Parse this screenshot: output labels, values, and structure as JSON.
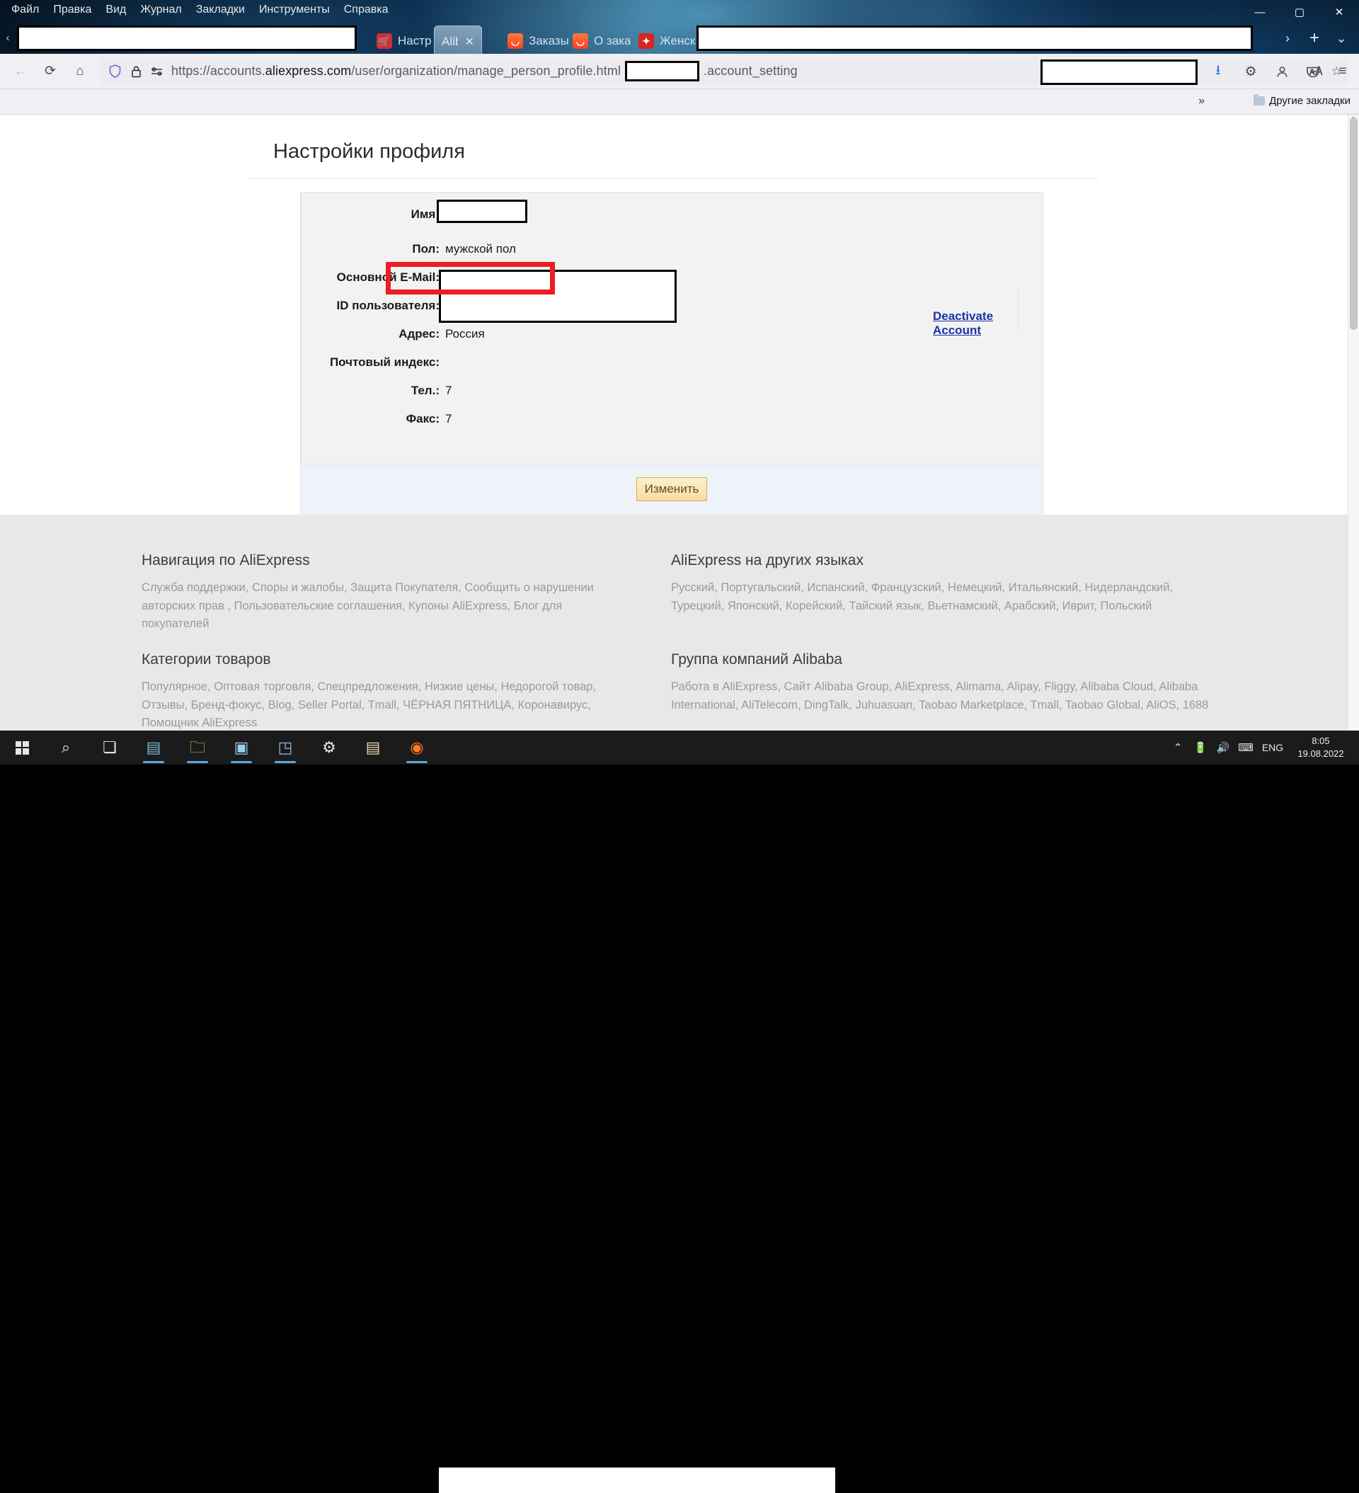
{
  "browser": {
    "menu_items": [
      "Файл",
      "Правка",
      "Вид",
      "Журнал",
      "Закладки",
      "Инструменты",
      "Справка"
    ],
    "window_controls": {
      "minimize": "—",
      "maximize": "▢",
      "close": "✕"
    },
    "tabs": [
      {
        "label": "Настр",
        "icon": "cart-icon",
        "active": false
      },
      {
        "label": "Alibaba",
        "icon": "none",
        "active": true,
        "close": "✕"
      },
      {
        "label": "Заказы",
        "icon": "aliexpress-icon",
        "active": false
      },
      {
        "label": "О зака",
        "icon": "aliexpress-icon",
        "active": false
      },
      {
        "label": "Женск",
        "icon": "star-icon",
        "active": false
      }
    ],
    "tab_new_label": "+",
    "tab_list_label": "⌄",
    "tab_scroll_right": "›",
    "nav": {
      "back": "←",
      "forward": "→",
      "reload": "⟳",
      "home": "⌂",
      "shield": "shield-icon",
      "lock": "lock-icon",
      "permissions": "permissions-icon",
      "translate": "translate-icon",
      "bookmark_star": "☆",
      "downloads": "⭳",
      "extensions": "⚙",
      "account": "account-icon",
      "save_to_pocket": "pocket-icon",
      "app_menu": "≡"
    },
    "url": {
      "scheme": "https://accounts.",
      "domain": "aliexpress.com",
      "path_before_redaction": "/user/organization/manage_person_profile.html",
      "path_after_redaction": ".account_setting",
      "full": "https://accounts.aliexpress.com/user/organization/manage_person_profile.html.account_setting"
    },
    "bookmarks": {
      "overflow_label": "»",
      "other_bookmarks": "Другие закладки",
      "folder_icon": "folder-icon"
    }
  },
  "page": {
    "title": "Настройки профиля",
    "deactivate_link": "Deactivate Account",
    "fields": [
      {
        "label": "Имя:",
        "value": "",
        "redacted": true
      },
      {
        "label": "Пол:",
        "value": "мужской пол",
        "highlighted": true
      },
      {
        "label": "Основной E-Mail:",
        "value": "",
        "redacted": true
      },
      {
        "label": "ID пользователя:",
        "value": "",
        "redacted": true
      },
      {
        "label": "Адрес:",
        "value": "Россия"
      },
      {
        "label": "Почтовый индекс:",
        "value": ""
      },
      {
        "label": "Тел.:",
        "value": "7"
      },
      {
        "label": "Факс:",
        "value": "7"
      }
    ],
    "submit_button": "Изменить",
    "highlight_color": "#ee1c25"
  },
  "footer": {
    "columns": [
      {
        "heading": "Навигация по AliExpress",
        "text": "Служба поддержки, Споры и жалобы, Защита Покупателя, Сообщить о нарушении авторских прав  , Пользовательские соглашения, Купоны AliExpress, Блог для покупателей"
      },
      {
        "heading": "AliExpress на других языках",
        "text": "Русский, Португальский, Испанский, Французский, Немецкий, Итальянский, Нидерландский, Турецкий, Японский, Корейский, Тайский язык, Вьетнамский, Арабский, Иврит, Польский"
      },
      {
        "heading": "Категории товаров",
        "text": "  Популярное, Оптовая торговля, Спецпредложения, Низкие цены, Недорогой товар, Отзывы, Бренд-фокус, Blog, Seller Portal, Tmall, ЧЁРНАЯ ПЯТНИЦА, Коронавирус, Помощник AliExpress"
      },
      {
        "heading": "Группа компаний Alibaba",
        "text": "  Работа в AliExpress, Сайт Alibaba Group, AliExpress, Alimama, Alipay, Fliggy, Alibaba Cloud, Alibaba International, AliTelecom, DingTalk, Juhuasuan, Taobao Marketplace, Tmall, Taobao Global, AliOS, 1688"
      }
    ]
  },
  "taskbar": {
    "start": "start-button",
    "search": "search-icon",
    "task_view": "task-view-icon",
    "apps": [
      {
        "name": "media-app-icon",
        "glyph": "▤"
      },
      {
        "name": "file-explorer-icon",
        "glyph": "🗀"
      },
      {
        "name": "photos-app-icon",
        "glyph": "▣"
      },
      {
        "name": "store-app-icon",
        "glyph": "◳"
      },
      {
        "name": "settings-app-icon",
        "glyph": "⚙"
      },
      {
        "name": "notepad-app-icon",
        "glyph": "▤"
      },
      {
        "name": "firefox-app-icon",
        "glyph": "◉"
      }
    ],
    "tray": {
      "show_hidden": "⌃",
      "battery": "battery-icon",
      "volume": "volume-icon",
      "keyboard": "keyboard-icon",
      "language": "ENG",
      "time": "8:05",
      "date": "19.08.2022"
    }
  }
}
